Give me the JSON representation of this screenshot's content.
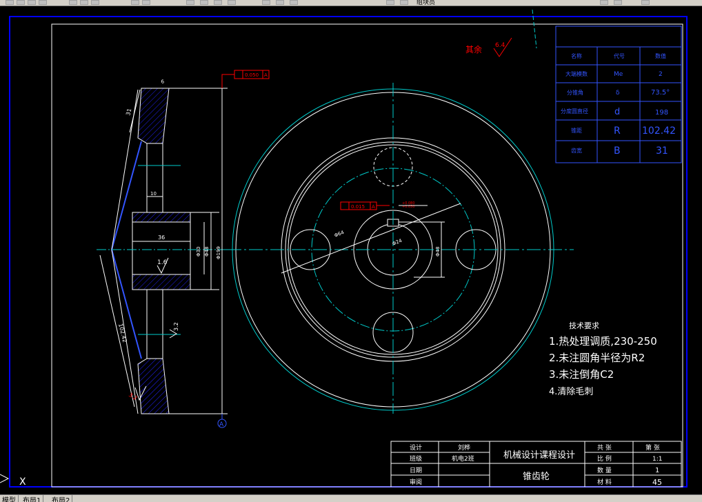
{
  "toolbar": {
    "search_text": "组块员"
  },
  "tabs": [
    "模型",
    "布局1",
    "布局2"
  ],
  "ucs": {
    "x_label": "X"
  },
  "drawing": {
    "roughness_label": "其余",
    "roughness_value": "6.4",
    "tolerance_top": "0.050",
    "tolerance_top_datum": "A",
    "tolerance_mid": "0.015",
    "tolerance_mid_datum": "A",
    "keyway_tol": "+0.080\n+0.030",
    "datum_label": "A",
    "dims": {
      "d31": "31",
      "d6": "6",
      "d10": "10",
      "d36": "36",
      "d1_6": "1.6",
      "dia_a": "Φ30",
      "dia_b": "Φ48",
      "dia_c": "Φ199",
      "d102": "102.42",
      "d64": "Φ64",
      "d24": "Φ24",
      "d48v": "Φ48",
      "r3_2": "3.2",
      "r_low": "3.2"
    },
    "params": {
      "headers": [
        "名称",
        "代号",
        "数值"
      ],
      "rows": [
        [
          "大端模数",
          "Me",
          "2"
        ],
        [
          "分锥角",
          "δ",
          "73.5°"
        ],
        [
          "分度圆直径",
          "d",
          "198"
        ],
        [
          "锥距",
          "R",
          "102.42"
        ],
        [
          "齿宽",
          "B",
          "31"
        ]
      ]
    },
    "tech": {
      "title": "技术要求",
      "items": [
        "1.热处理调质,230-250",
        "2.未注圆角半径为R2",
        "3.未注倒角C2",
        "4.清除毛刺"
      ]
    },
    "title_block": {
      "left": [
        [
          "设计",
          "刘桦"
        ],
        [
          "班级",
          "机电2班"
        ],
        [
          "日期",
          ""
        ],
        [
          "审阅",
          ""
        ]
      ],
      "course": "机械设计课程设计",
      "part": "锥齿轮",
      "right": [
        [
          "共 张",
          "第 张"
        ],
        [
          "比 例",
          "1:1"
        ],
        [
          "数 量",
          "1"
        ],
        [
          "材 料",
          "45"
        ]
      ]
    }
  }
}
